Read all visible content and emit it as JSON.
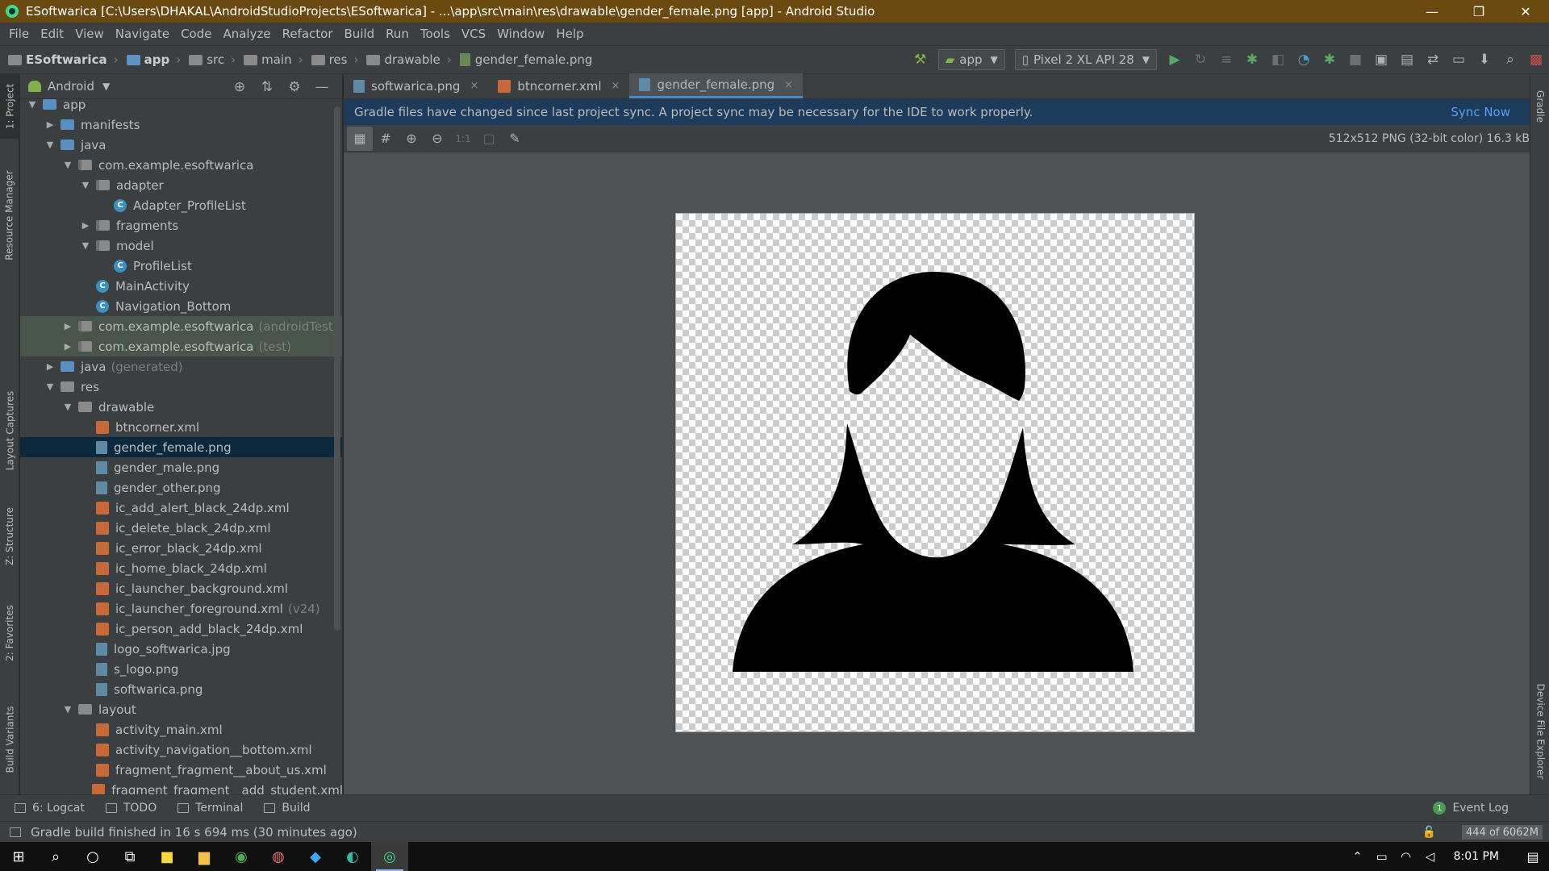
{
  "window": {
    "title": "ESoftwarica [C:\\Users\\DHAKAL\\AndroidStudioProjects\\ESoftwarica] - ...\\app\\src\\main\\res\\drawable\\gender_female.png [app] - Android Studio",
    "minimize": "—",
    "restore": "❐",
    "close": "✕"
  },
  "menu": [
    "File",
    "Edit",
    "View",
    "Navigate",
    "Code",
    "Analyze",
    "Refactor",
    "Build",
    "Run",
    "Tools",
    "VCS",
    "Window",
    "Help"
  ],
  "breadcrumb": [
    "ESoftwarica",
    "app",
    "src",
    "main",
    "res",
    "drawable",
    "gender_female.png"
  ],
  "toolbar": {
    "run_config": "app",
    "device": "Pixel 2 XL API 28"
  },
  "left_strip": {
    "project": "1: Project",
    "resource_manager": "Resource Manager",
    "layout_captures": "Layout Captures",
    "structure": "Z: Structure",
    "favorites": "2: Favorites",
    "build_variants": "Build Variants"
  },
  "right_strip": {
    "gradle": "Gradle",
    "device_file_explorer": "Device File Explorer"
  },
  "project_panel": {
    "view_label": "Android",
    "tree": [
      {
        "label": "app",
        "indent": 0,
        "arrow": "▼",
        "icon": "folder-blue"
      },
      {
        "label": "manifests",
        "indent": 1,
        "arrow": "▶",
        "icon": "folder-blue"
      },
      {
        "label": "java",
        "indent": 1,
        "arrow": "▼",
        "icon": "folder-blue"
      },
      {
        "label": "com.example.esoftwarica",
        "indent": 2,
        "arrow": "▼",
        "icon": "package"
      },
      {
        "label": "adapter",
        "indent": 3,
        "arrow": "▼",
        "icon": "package"
      },
      {
        "label": "Adapter_ProfileList",
        "indent": 4,
        "arrow": "",
        "icon": "class"
      },
      {
        "label": "fragments",
        "indent": 3,
        "arrow": "▶",
        "icon": "package"
      },
      {
        "label": "model",
        "indent": 3,
        "arrow": "▼",
        "icon": "package"
      },
      {
        "label": "ProfileList",
        "indent": 4,
        "arrow": "",
        "icon": "class"
      },
      {
        "label": "MainActivity",
        "indent": 3,
        "arrow": "",
        "icon": "class"
      },
      {
        "label": "Navigation_Bottom",
        "indent": 3,
        "arrow": "",
        "icon": "class"
      },
      {
        "label": "com.example.esoftwarica",
        "suffix": "(androidTest)",
        "indent": 2,
        "arrow": "▶",
        "icon": "package",
        "state": "test"
      },
      {
        "label": "com.example.esoftwarica",
        "suffix": "(test)",
        "indent": 2,
        "arrow": "▶",
        "icon": "package",
        "state": "test"
      },
      {
        "label": "java",
        "suffix": "(generated)",
        "indent": 1,
        "arrow": "▶",
        "icon": "folder-blue"
      },
      {
        "label": "res",
        "indent": 1,
        "arrow": "▼",
        "icon": "folder"
      },
      {
        "label": "drawable",
        "indent": 2,
        "arrow": "▼",
        "icon": "folder"
      },
      {
        "label": "btncorner.xml",
        "indent": 3,
        "arrow": "",
        "icon": "xml"
      },
      {
        "label": "gender_female.png",
        "indent": 3,
        "arrow": "",
        "icon": "png",
        "state": "selected"
      },
      {
        "label": "gender_male.png",
        "indent": 3,
        "arrow": "",
        "icon": "png"
      },
      {
        "label": "gender_other.png",
        "indent": 3,
        "arrow": "",
        "icon": "png"
      },
      {
        "label": "ic_add_alert_black_24dp.xml",
        "indent": 3,
        "arrow": "",
        "icon": "xml"
      },
      {
        "label": "ic_delete_black_24dp.xml",
        "indent": 3,
        "arrow": "",
        "icon": "xml"
      },
      {
        "label": "ic_error_black_24dp.xml",
        "indent": 3,
        "arrow": "",
        "icon": "xml"
      },
      {
        "label": "ic_home_black_24dp.xml",
        "indent": 3,
        "arrow": "",
        "icon": "xml"
      },
      {
        "label": "ic_launcher_background.xml",
        "indent": 3,
        "arrow": "",
        "icon": "xml"
      },
      {
        "label": "ic_launcher_foreground.xml",
        "suffix": "(v24)",
        "indent": 3,
        "arrow": "",
        "icon": "xml"
      },
      {
        "label": "ic_person_add_black_24dp.xml",
        "indent": 3,
        "arrow": "",
        "icon": "xml"
      },
      {
        "label": "logo_softwarica.jpg",
        "indent": 3,
        "arrow": "",
        "icon": "png"
      },
      {
        "label": "s_logo.png",
        "indent": 3,
        "arrow": "",
        "icon": "png"
      },
      {
        "label": "softwarica.png",
        "indent": 3,
        "arrow": "",
        "icon": "png"
      },
      {
        "label": "layout",
        "indent": 2,
        "arrow": "▼",
        "icon": "folder"
      },
      {
        "label": "activity_main.xml",
        "indent": 3,
        "arrow": "",
        "icon": "xml"
      },
      {
        "label": "activity_navigation__bottom.xml",
        "indent": 3,
        "arrow": "",
        "icon": "xml"
      },
      {
        "label": "fragment_fragment__about_us.xml",
        "indent": 3,
        "arrow": "",
        "icon": "xml"
      },
      {
        "label": "fragment_fragment__add_student.xml",
        "indent": 3,
        "arrow": "",
        "icon": "xml"
      }
    ]
  },
  "editor": {
    "tabs": [
      {
        "label": "softwarica.png",
        "icon": "png",
        "active": false
      },
      {
        "label": "btncorner.xml",
        "icon": "xml",
        "active": false
      },
      {
        "label": "gender_female.png",
        "icon": "png",
        "active": true
      }
    ],
    "banner_text": "Gradle files have changed since last project sync. A project sync may be necessary for the IDE to work properly.",
    "sync_now": "Sync Now",
    "image_info": "512x512 PNG (32-bit color) 16.3 kB",
    "zoom_1to1": "1:1"
  },
  "bottom_tabs": [
    {
      "label": "6: Logcat",
      "icon": "logcat-icon"
    },
    {
      "label": "TODO",
      "icon": "todo-icon"
    },
    {
      "label": "Terminal",
      "icon": "terminal-icon"
    },
    {
      "label": "Build",
      "icon": "build-icon"
    }
  ],
  "event_log": {
    "count": "1",
    "label": "Event Log"
  },
  "status": {
    "message": "Gradle build finished in 16 s 694 ms (30 minutes ago)",
    "memory": "444 of 6062M"
  },
  "taskbar": {
    "clock": "8:01 PM"
  },
  "colors": {
    "title_bar": "#6b4a12",
    "selection": "#0d293e",
    "accent": "#4a88c7",
    "link": "#589df6"
  }
}
